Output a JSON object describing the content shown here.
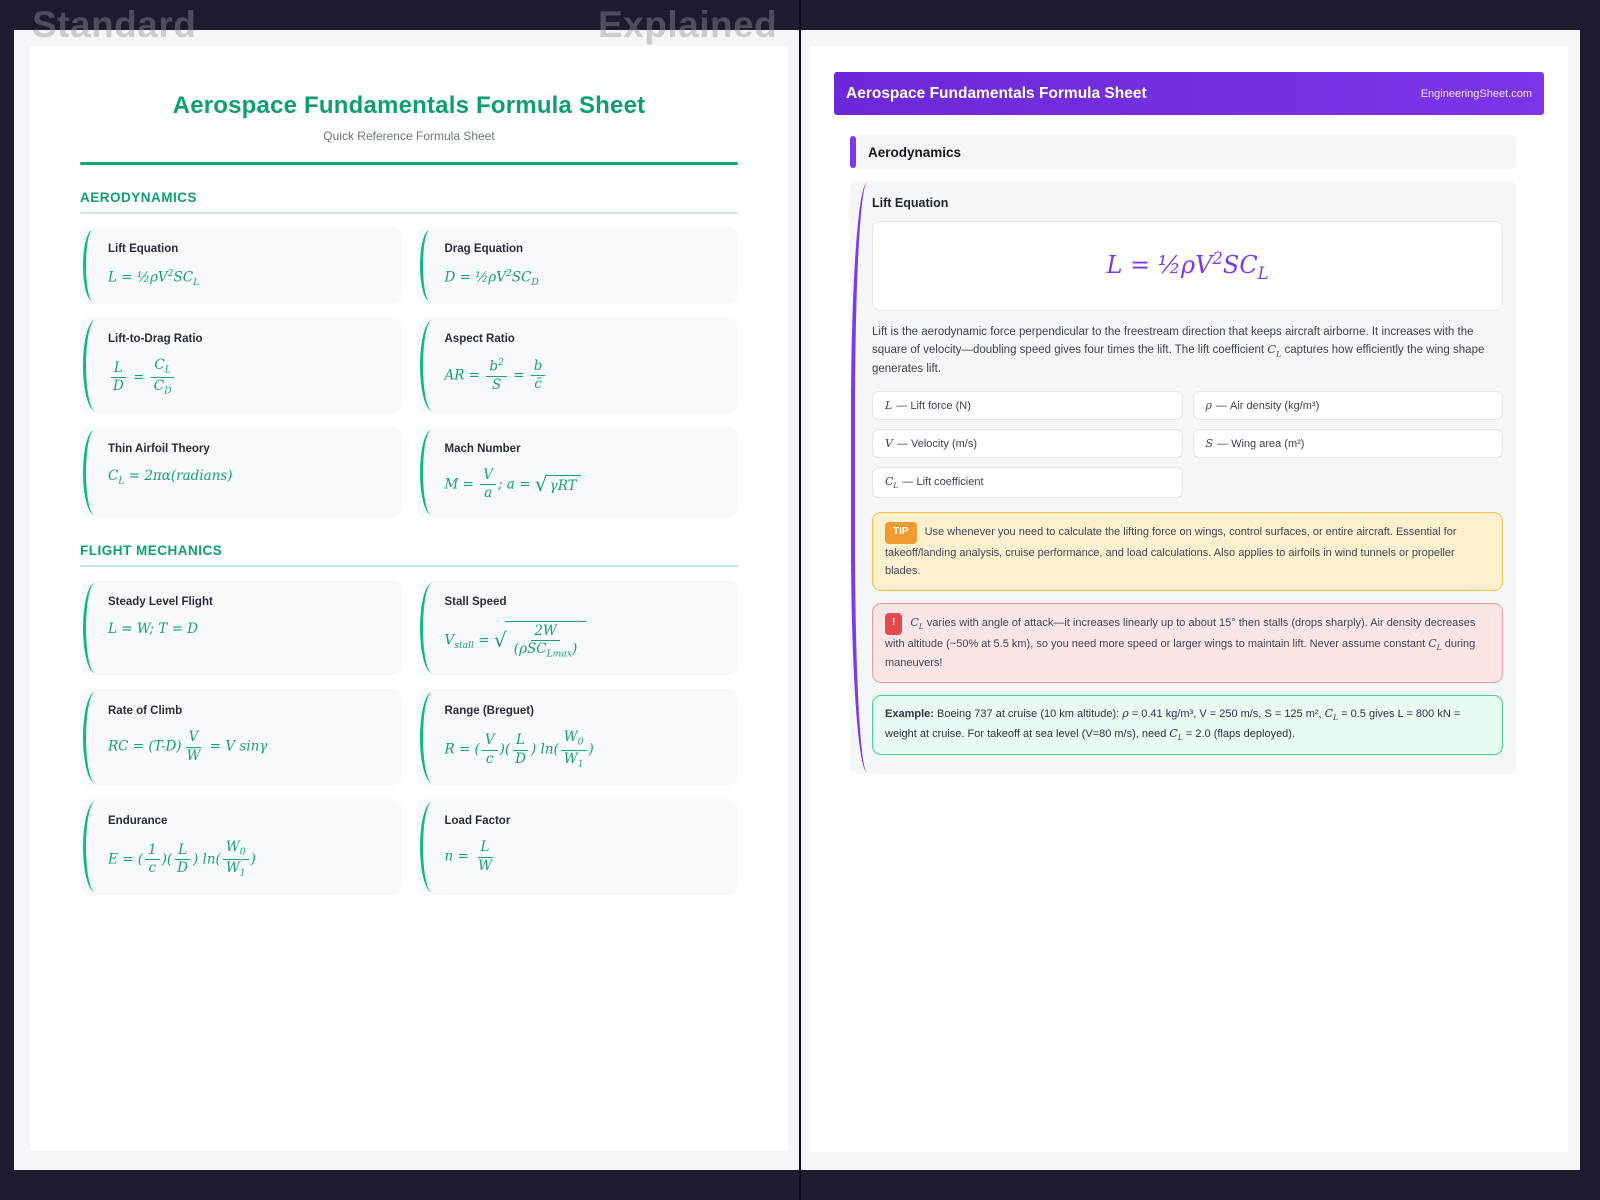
{
  "compare": {
    "left_label": "Standard",
    "right_label": "Explained"
  },
  "standard": {
    "title": "Aerospace Fundamentals Formula Sheet",
    "subtitle": "Quick Reference Formula Sheet",
    "sections": [
      {
        "title": "AERODYNAMICS",
        "cards": [
          {
            "title": "Lift Equation",
            "formula": "L = ½ρV^{2}SC_{L}"
          },
          {
            "title": "Drag Equation",
            "formula": "D = ½ρV^{2}SC_{D}"
          },
          {
            "title": "Lift-to-Drag Ratio",
            "formula": "\\f{L}{D} = \\f{C_{L}}{C_{D}}"
          },
          {
            "title": "Aspect Ratio",
            "formula": "AR = \\f{b^{2}}{S} = \\f{b}{c̄}"
          },
          {
            "title": "Thin Airfoil Theory",
            "formula": "C_{L} = 2πα(radians)"
          },
          {
            "title": "Mach Number",
            "formula": "M = \\f{V}{a}; a = \\s{γRT}"
          }
        ]
      },
      {
        "title": "FLIGHT MECHANICS",
        "cards": [
          {
            "title": "Steady Level Flight",
            "formula": "L = W; T = D"
          },
          {
            "title": "Stall Speed",
            "formula": "V_{stall} = \\s{\\f{2W}{(ρSC_{Lmax})}}"
          },
          {
            "title": "Rate of Climb",
            "formula": "RC = (T-D)\\f{V}{W} = V sinγ"
          },
          {
            "title": "Range (Breguet)",
            "formula": "R = (\\f{V}{c})(\\f{L}{D}) ln(\\f{W_{0}}{W_{1}})"
          },
          {
            "title": "Endurance",
            "formula": "E = (\\f{1}{c})(\\f{L}{D}) ln(\\f{W_{0}}{W_{1}})"
          },
          {
            "title": "Load Factor",
            "formula": "n = \\f{L}{W}"
          }
        ]
      }
    ]
  },
  "explained": {
    "header": {
      "title": "Aerospace Fundamentals Formula Sheet",
      "site": "EngineeringSheet.com"
    },
    "section_title": "Aerodynamics",
    "topic": {
      "title": "Lift Equation",
      "formula": "L = ½ρV^{2}SC_{L}",
      "description": "Lift is the aerodynamic force perpendicular to the freestream direction that keeps aircraft airborne. It increases with the square of velocity—doubling speed gives four times the lift. The lift coefficient $C_{L}$ captures how efficiently the wing shape generates lift.",
      "variables": [
        {
          "symbol": "L",
          "desc": "— Lift force (N)"
        },
        {
          "symbol": "ρ",
          "desc": "— Air density (kg/m³)"
        },
        {
          "symbol": "V",
          "desc": "— Velocity (m/s)"
        },
        {
          "symbol": "S",
          "desc": "— Wing area (m²)"
        },
        {
          "symbol": "C_{L}",
          "desc": "— Lift coefficient"
        }
      ],
      "tip_label": "TIP",
      "tip": "Use whenever you need to calculate the lifting force on wings, control surfaces, or entire aircraft. Essential for takeoff/landing analysis, cruise performance, and load calculations. Also applies to airfoils in wind tunnels or propeller blades.",
      "warning_label": "!",
      "warning": "$C_{L}$ varies with angle of attack—it increases linearly up to about 15° then stalls (drops sharply). Air density decreases with altitude (~50% at 5.5 km), so you need more speed or larger wings to maintain lift. Never assume constant $C_{L}$ during maneuvers!",
      "example_label": "Example:",
      "example": "Boeing 737 at cruise (10 km altitude): $ρ$ = 0.41 kg/m³, V = 250 m/s, S = 125 m², $C_{L}$ = 0.5 gives L = 800 kN = weight at cruise. For takeoff at sea level (V=80 m/s), need $C_{L}$ = 2.0 (flaps deployed)."
    }
  },
  "colors": {
    "accent_green": "#10b981",
    "accent_purple": "#7c3aed",
    "background_navy": "#1c1c30"
  }
}
